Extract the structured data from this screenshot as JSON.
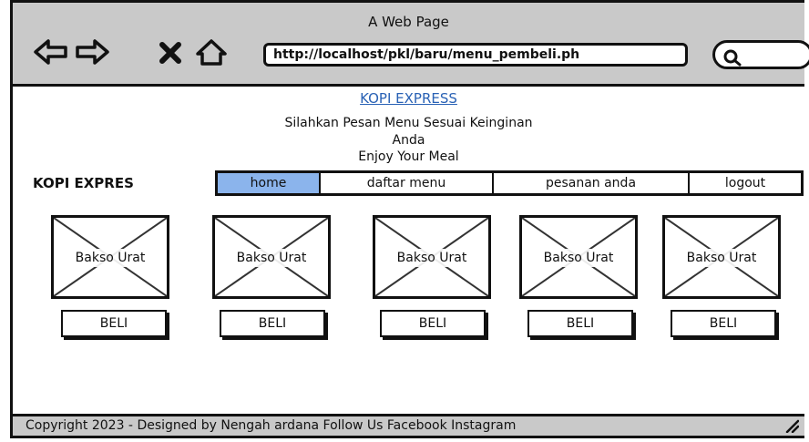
{
  "window": {
    "title": "A Web Page"
  },
  "browser": {
    "url": "http://localhost/pkl/baru/menu_pembeli.ph",
    "icons": [
      "back-arrow-icon",
      "forward-arrow-icon",
      "close-icon",
      "home-icon",
      "search-icon"
    ]
  },
  "header": {
    "title_link": "KOPI EXPRESS",
    "line1": "Silahkan Pesan Menu Sesuai Keinginan",
    "line2": "Anda",
    "line3": "Enjoy Your Meal"
  },
  "brand": "KOPI EXPRES",
  "nav": {
    "items": [
      {
        "label": "home",
        "active": true
      },
      {
        "label": "daftar menu",
        "active": false
      },
      {
        "label": "pesanan anda",
        "active": false
      },
      {
        "label": "logout",
        "active": false
      }
    ]
  },
  "products": [
    {
      "name": "Bakso Urat",
      "button": "BELI"
    },
    {
      "name": "Bakso Urat",
      "button": "BELI"
    },
    {
      "name": "Bakso Urat",
      "button": "BELI"
    },
    {
      "name": "Bakso Urat",
      "button": "BELI"
    },
    {
      "name": "Bakso Urat",
      "button": "BELI"
    }
  ],
  "footer": {
    "text": "Copyright  2023 - Designed by Nengah ardana    Follow Us Facebook Instagram"
  },
  "colors": {
    "chrome": "#c9c9c9",
    "active_tab": "#8bb4ec",
    "link": "#2a62b5"
  }
}
